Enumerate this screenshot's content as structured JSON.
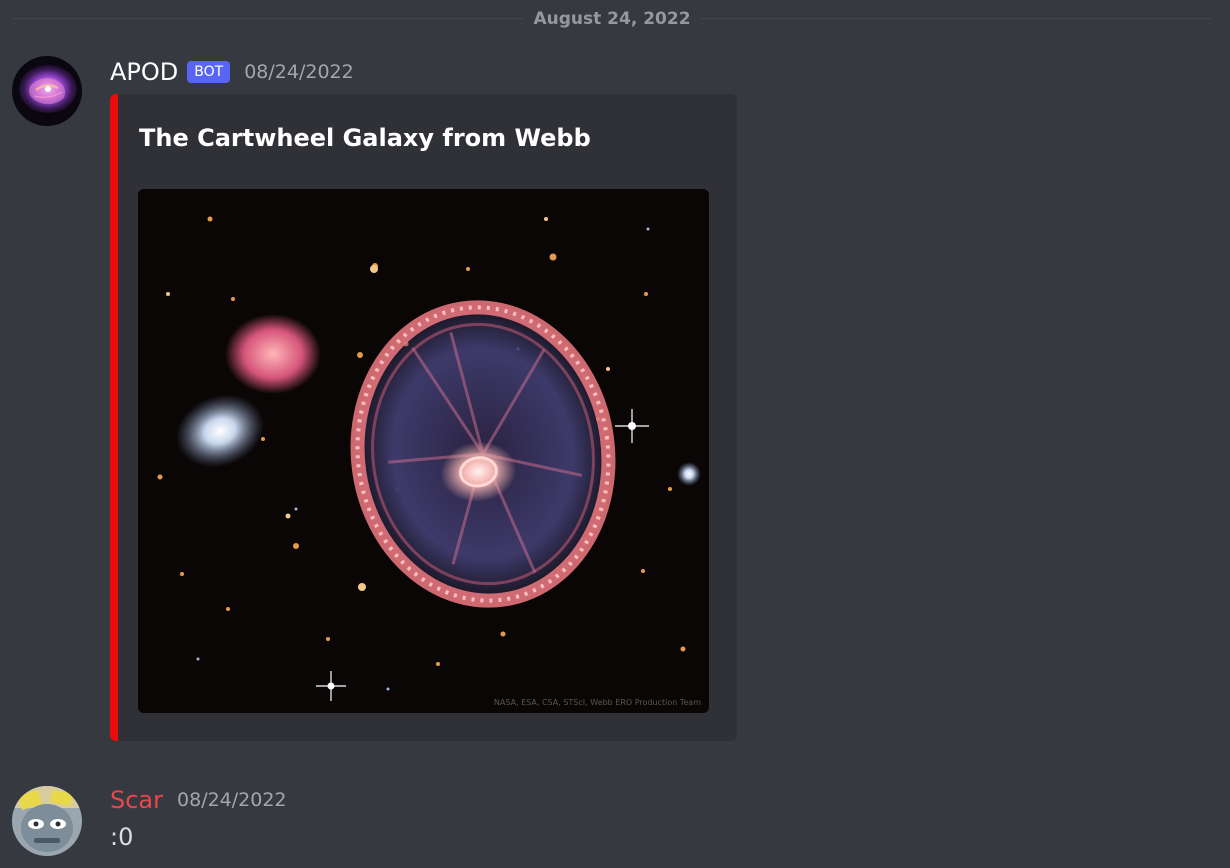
{
  "channel": {
    "date_divider": "August 24, 2022"
  },
  "messages": [
    {
      "author": "APOD",
      "is_bot": true,
      "bot_tag": "BOT",
      "timestamp": "08/24/2022",
      "avatar_icon": "nebula-avatar-icon",
      "embed": {
        "accent_color": "#ed0a0a",
        "title": "The Cartwheel Galaxy from Webb",
        "image_credit": "NASA, ESA, CSA, STScI, Webb ERO Production Team"
      }
    },
    {
      "author": "Scar",
      "author_color": "#e8474c",
      "timestamp": "08/24/2022",
      "avatar_icon": "robot-avatar-icon",
      "text": ":0"
    }
  ]
}
